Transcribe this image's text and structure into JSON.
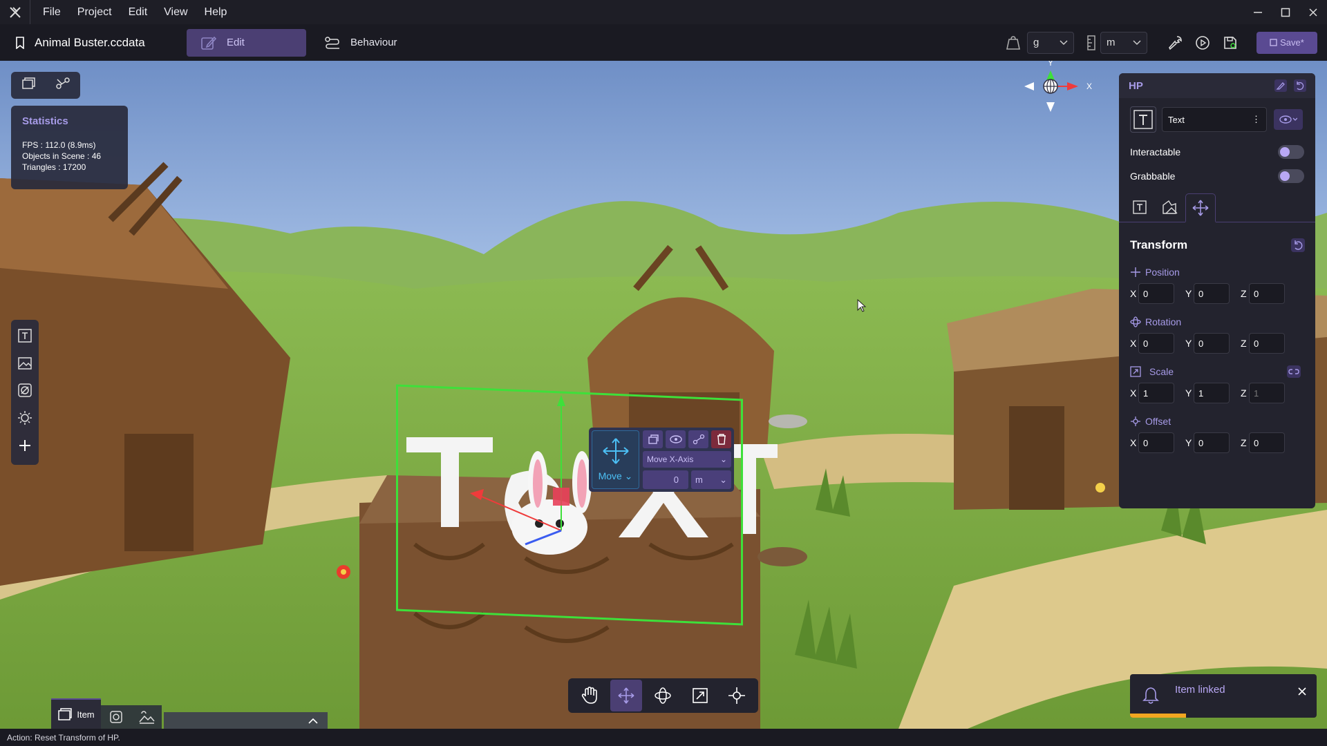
{
  "menu": {
    "items": [
      "File",
      "Project",
      "Edit",
      "View",
      "Help"
    ]
  },
  "project": {
    "name": "Animal Buster.ccdata"
  },
  "mode_tabs": [
    {
      "label": "Edit"
    },
    {
      "label": "Behaviour"
    }
  ],
  "header": {
    "mass_unit": "g",
    "length_unit": "m",
    "save_label": "Save*"
  },
  "stats": {
    "title": "Statistics",
    "fps": "FPS : 112.0 (8.9ms)",
    "objects": "Objects in Scene : 46",
    "triangles": "Triangles : 17200"
  },
  "axis_gizmo": {
    "y": "Y",
    "x": "X"
  },
  "scene_text": "Text",
  "move_panel": {
    "mode_label": "Move",
    "axis_select": "Move X-Axis",
    "value": "0",
    "unit": "m"
  },
  "bottom_left": {
    "tabs": [
      {
        "label": "Item"
      }
    ]
  },
  "props": {
    "name": "HP",
    "component": "Text",
    "interactable_label": "Interactable",
    "grabbable_label": "Grabbable",
    "transform_title": "Transform",
    "position": {
      "label": "Position",
      "x": "0",
      "y": "0",
      "z": "0"
    },
    "rotation": {
      "label": "Rotation",
      "x": "0",
      "y": "0",
      "z": "0"
    },
    "scale": {
      "label": "Scale",
      "x": "1",
      "y": "1",
      "z": "1"
    },
    "offset": {
      "label": "Offset",
      "x": "0",
      "y": "0",
      "z": "0"
    }
  },
  "toast": {
    "message": "Item linked",
    "progress": 0.3
  },
  "status": {
    "text": "Action: Reset Transform of HP."
  },
  "colors": {
    "accent": "#5a4a92",
    "accent_text": "#a79be8",
    "selection": "#3ee03a",
    "toast_progress": "#f2a621"
  }
}
